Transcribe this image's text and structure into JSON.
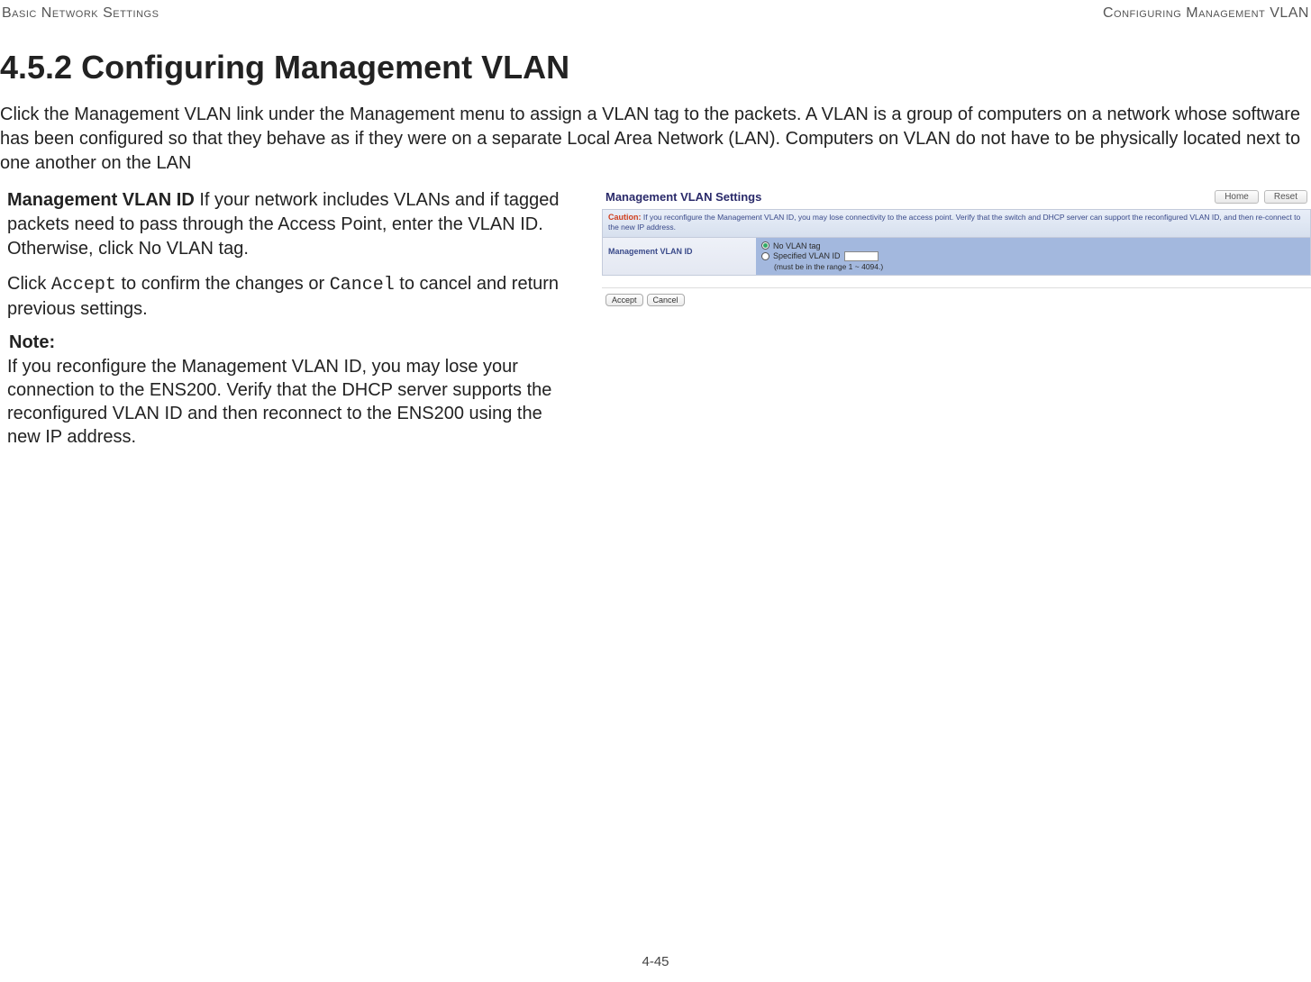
{
  "header": {
    "left": "Basic Network Settings",
    "right": "Configuring Management VLAN"
  },
  "section": {
    "number": "4.5.2",
    "title": "Configuring Management VLAN"
  },
  "intro": "Click the Management VLAN link under the Management menu to assign a VLAN tag to the packets. A VLAN is a group of computers on a network whose software has been configured so that they behave as if they were on a separate Local Area Network (LAN). Computers on VLAN do not have to be physically located next to one another on the LAN",
  "definition": {
    "term": "Management VLAN ID",
    "text": "  If your network includes VLANs and if tagged packets need to pass through the Access Point, enter the VLAN ID. Otherwise, click No VLAN tag."
  },
  "action_sentence": {
    "p1": "Click ",
    "accept": "Accept",
    "p2": " to confirm the changes or ",
    "cancel": "Cancel",
    "p3": " to cancel and return previous settings."
  },
  "note": {
    "label": "Note:",
    "text": "If you reconfigure the Management VLAN ID, you may lose your connection to the ENS200. Verify that the DHCP server supports the reconfigured VLAN ID and then reconnect to the ENS200 using the new IP address."
  },
  "screenshot": {
    "panel_title": "Management VLAN Settings",
    "buttons": {
      "home": "Home",
      "reset": "Reset"
    },
    "caution_label": "Caution:",
    "caution_text": " If you reconfigure the Management VLAN ID, you may lose connectivity to the access point. Verify that the switch and DHCP server can support the reconfigured VLAN ID, and then re-connect to the new IP address.",
    "row_label": "Management VLAN ID",
    "opt_no_vlan": "No VLAN tag",
    "opt_specified": "Specified VLAN ID",
    "vlan_value": "",
    "range_note": "(must be in the range 1 ~ 4094.)",
    "accept": "Accept",
    "cancel": "Cancel"
  },
  "page_number": "4-45"
}
